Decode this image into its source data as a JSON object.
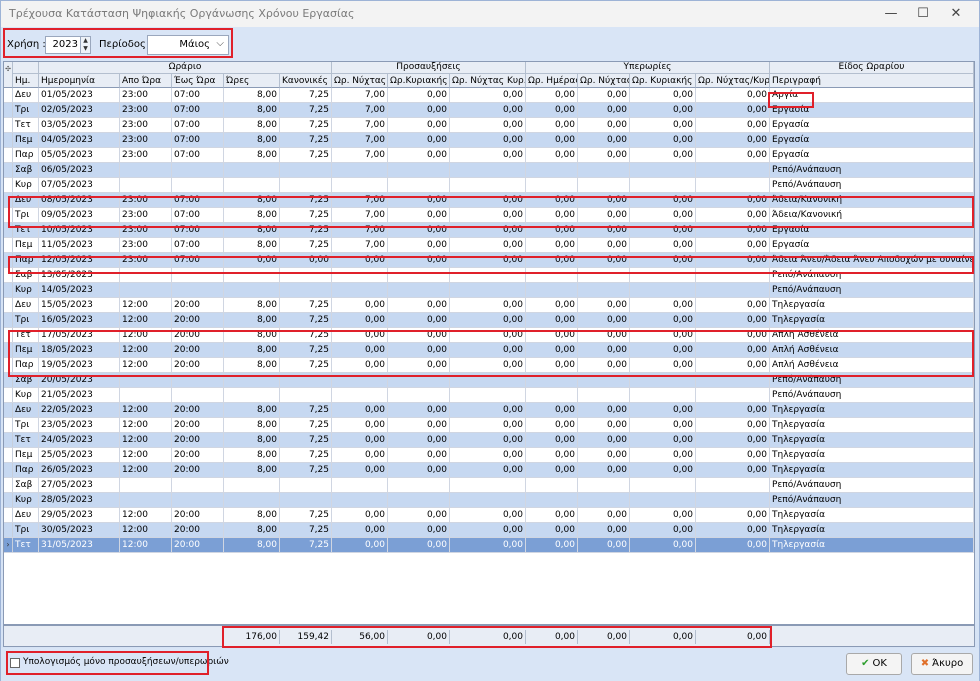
{
  "window": {
    "title": "Τρέχουσα Κατάσταση Ψηφιακής Οργάνωσης Χρόνου Εργασίας",
    "minimize_glyph": "—",
    "maximize_glyph": "☐",
    "close_glyph": "✕"
  },
  "toolbar": {
    "year_label": "Χρήση :",
    "year_value": "2023",
    "period_label": "Περίοδος :",
    "period_value": "Μάιος"
  },
  "grid": {
    "groups": [
      "Ωράριο",
      "Προσαυξήσεις",
      "Υπερωρίες",
      "Είδος Ωραρίου"
    ],
    "columns": [
      "Ημ.",
      "Ημερομηνία",
      "Απο Ώρα",
      "Έως Ώρα",
      "Ώρες",
      "Κανονικές",
      "Ωρ. Νύχτας",
      "Ωρ.Κυριακής",
      "Ωρ. Νύχτας Κυρ.",
      "Ωρ. Ημέρας",
      "Ωρ. Νύχτας",
      "Ωρ. Κυριακής",
      "Ωρ. Νύχτας/Κυρ.",
      "Περιγραφή"
    ],
    "rows": [
      [
        "Δευ",
        "01/05/2023",
        "23:00",
        "07:00",
        "8,00",
        "7,25",
        "7,00",
        "0,00",
        "0,00",
        "0,00",
        "0,00",
        "0,00",
        "0,00",
        "Αργία"
      ],
      [
        "Τρι",
        "02/05/2023",
        "23:00",
        "07:00",
        "8,00",
        "7,25",
        "7,00",
        "0,00",
        "0,00",
        "0,00",
        "0,00",
        "0,00",
        "0,00",
        "Εργασία"
      ],
      [
        "Τετ",
        "03/05/2023",
        "23:00",
        "07:00",
        "8,00",
        "7,25",
        "7,00",
        "0,00",
        "0,00",
        "0,00",
        "0,00",
        "0,00",
        "0,00",
        "Εργασία"
      ],
      [
        "Πεμ",
        "04/05/2023",
        "23:00",
        "07:00",
        "8,00",
        "7,25",
        "7,00",
        "0,00",
        "0,00",
        "0,00",
        "0,00",
        "0,00",
        "0,00",
        "Εργασία"
      ],
      [
        "Παρ",
        "05/05/2023",
        "23:00",
        "07:00",
        "8,00",
        "7,25",
        "7,00",
        "0,00",
        "0,00",
        "0,00",
        "0,00",
        "0,00",
        "0,00",
        "Εργασία"
      ],
      [
        "Σαβ",
        "06/05/2023",
        "",
        "",
        "",
        "",
        "",
        "",
        "",
        "",
        "",
        "",
        "",
        "Ρεπό/Ανάπαυση"
      ],
      [
        "Κυρ",
        "07/05/2023",
        "",
        "",
        "",
        "",
        "",
        "",
        "",
        "",
        "",
        "",
        "",
        "Ρεπό/Ανάπαυση"
      ],
      [
        "Δευ",
        "08/05/2023",
        "23:00",
        "07:00",
        "8,00",
        "7,25",
        "7,00",
        "0,00",
        "0,00",
        "0,00",
        "0,00",
        "0,00",
        "0,00",
        "Άδεια/Κανονική"
      ],
      [
        "Τρι",
        "09/05/2023",
        "23:00",
        "07:00",
        "8,00",
        "7,25",
        "7,00",
        "0,00",
        "0,00",
        "0,00",
        "0,00",
        "0,00",
        "0,00",
        "Άδεια/Κανονική"
      ],
      [
        "Τετ",
        "10/05/2023",
        "23:00",
        "07:00",
        "8,00",
        "7,25",
        "7,00",
        "0,00",
        "0,00",
        "0,00",
        "0,00",
        "0,00",
        "0,00",
        "Εργασία"
      ],
      [
        "Πεμ",
        "11/05/2023",
        "23:00",
        "07:00",
        "8,00",
        "7,25",
        "7,00",
        "0,00",
        "0,00",
        "0,00",
        "0,00",
        "0,00",
        "0,00",
        "Εργασία"
      ],
      [
        "Παρ",
        "12/05/2023",
        "23:00",
        "07:00",
        "0,00",
        "0,00",
        "0,00",
        "0,00",
        "0,00",
        "0,00",
        "0,00",
        "0,00",
        "0,00",
        "Άδεια Άνευ/Άδεια Άνευ Αποδοχών με συναίνεση ε"
      ],
      [
        "Σαβ",
        "13/05/2023",
        "",
        "",
        "",
        "",
        "",
        "",
        "",
        "",
        "",
        "",
        "",
        "Ρεπό/Ανάπαυση"
      ],
      [
        "Κυρ",
        "14/05/2023",
        "",
        "",
        "",
        "",
        "",
        "",
        "",
        "",
        "",
        "",
        "",
        "Ρεπό/Ανάπαυση"
      ],
      [
        "Δευ",
        "15/05/2023",
        "12:00",
        "20:00",
        "8,00",
        "7,25",
        "0,00",
        "0,00",
        "0,00",
        "0,00",
        "0,00",
        "0,00",
        "0,00",
        "Τηλεργασία"
      ],
      [
        "Τρι",
        "16/05/2023",
        "12:00",
        "20:00",
        "8,00",
        "7,25",
        "0,00",
        "0,00",
        "0,00",
        "0,00",
        "0,00",
        "0,00",
        "0,00",
        "Τηλεργασία"
      ],
      [
        "Τετ",
        "17/05/2023",
        "12:00",
        "20:00",
        "8,00",
        "7,25",
        "0,00",
        "0,00",
        "0,00",
        "0,00",
        "0,00",
        "0,00",
        "0,00",
        "Απλή Ασθένεια"
      ],
      [
        "Πεμ",
        "18/05/2023",
        "12:00",
        "20:00",
        "8,00",
        "7,25",
        "0,00",
        "0,00",
        "0,00",
        "0,00",
        "0,00",
        "0,00",
        "0,00",
        "Απλή Ασθένεια"
      ],
      [
        "Παρ",
        "19/05/2023",
        "12:00",
        "20:00",
        "8,00",
        "7,25",
        "0,00",
        "0,00",
        "0,00",
        "0,00",
        "0,00",
        "0,00",
        "0,00",
        "Απλή Ασθένεια"
      ],
      [
        "Σαβ",
        "20/05/2023",
        "",
        "",
        "",
        "",
        "",
        "",
        "",
        "",
        "",
        "",
        "",
        "Ρεπό/Ανάπαυση"
      ],
      [
        "Κυρ",
        "21/05/2023",
        "",
        "",
        "",
        "",
        "",
        "",
        "",
        "",
        "",
        "",
        "",
        "Ρεπό/Ανάπαυση"
      ],
      [
        "Δευ",
        "22/05/2023",
        "12:00",
        "20:00",
        "8,00",
        "7,25",
        "0,00",
        "0,00",
        "0,00",
        "0,00",
        "0,00",
        "0,00",
        "0,00",
        "Τηλεργασία"
      ],
      [
        "Τρι",
        "23/05/2023",
        "12:00",
        "20:00",
        "8,00",
        "7,25",
        "0,00",
        "0,00",
        "0,00",
        "0,00",
        "0,00",
        "0,00",
        "0,00",
        "Τηλεργασία"
      ],
      [
        "Τετ",
        "24/05/2023",
        "12:00",
        "20:00",
        "8,00",
        "7,25",
        "0,00",
        "0,00",
        "0,00",
        "0,00",
        "0,00",
        "0,00",
        "0,00",
        "Τηλεργασία"
      ],
      [
        "Πεμ",
        "25/05/2023",
        "12:00",
        "20:00",
        "8,00",
        "7,25",
        "0,00",
        "0,00",
        "0,00",
        "0,00",
        "0,00",
        "0,00",
        "0,00",
        "Τηλεργασία"
      ],
      [
        "Παρ",
        "26/05/2023",
        "12:00",
        "20:00",
        "8,00",
        "7,25",
        "0,00",
        "0,00",
        "0,00",
        "0,00",
        "0,00",
        "0,00",
        "0,00",
        "Τηλεργασία"
      ],
      [
        "Σαβ",
        "27/05/2023",
        "",
        "",
        "",
        "",
        "",
        "",
        "",
        "",
        "",
        "",
        "",
        "Ρεπό/Ανάπαυση"
      ],
      [
        "Κυρ",
        "28/05/2023",
        "",
        "",
        "",
        "",
        "",
        "",
        "",
        "",
        "",
        "",
        "",
        "Ρεπό/Ανάπαυση"
      ],
      [
        "Δευ",
        "29/05/2023",
        "12:00",
        "20:00",
        "8,00",
        "7,25",
        "0,00",
        "0,00",
        "0,00",
        "0,00",
        "0,00",
        "0,00",
        "0,00",
        "Τηλεργασία"
      ],
      [
        "Τρι",
        "30/05/2023",
        "12:00",
        "20:00",
        "8,00",
        "7,25",
        "0,00",
        "0,00",
        "0,00",
        "0,00",
        "0,00",
        "0,00",
        "0,00",
        "Τηλεργασία"
      ],
      [
        "Τετ",
        "31/05/2023",
        "12:00",
        "20:00",
        "8,00",
        "7,25",
        "0,00",
        "0,00",
        "0,00",
        "0,00",
        "0,00",
        "0,00",
        "0,00",
        "Τηλεργασία"
      ]
    ],
    "selected_row": 30
  },
  "totals": [
    "176,00",
    "159,42",
    "56,00",
    "0,00",
    "0,00",
    "0,00",
    "0,00",
    "0,00",
    "0,00"
  ],
  "footer": {
    "checkbox_label": "Υπολογισμός μόνο προσαυξήσεων/υπερωριών",
    "ok_label": "ΟΚ",
    "cancel_label": "Άκυρο"
  },
  "colors": {
    "highlight": "#e0202a",
    "alt_row": "#c6d8f1",
    "selected_row": "#7b9fd5",
    "ok_icon": "#2e9e2e",
    "cancel_icon": "#e0702a"
  }
}
